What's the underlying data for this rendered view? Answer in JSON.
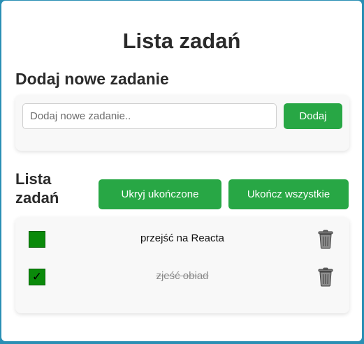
{
  "app": {
    "title": "Lista zadań"
  },
  "add_section": {
    "heading": "Dodaj nowe zadanie",
    "input_placeholder": "Dodaj nowe zadanie..",
    "input_value": "",
    "add_button": "Dodaj"
  },
  "list_section": {
    "heading": "Lista zadań",
    "hide_completed_button": "Ukryj ukończone",
    "complete_all_button": "Ukończ wszystkie",
    "items": [
      {
        "text": "przejść na Reacta",
        "completed": false,
        "check_mark": ""
      },
      {
        "text": "zjeść obiad",
        "completed": true,
        "check_mark": "✓"
      }
    ]
  },
  "colors": {
    "background": "#2a8fb4",
    "button": "#28a745",
    "checkbox": "#0a8a0a",
    "card": "#f8f8f8"
  },
  "icons": {
    "delete": "trash-icon",
    "check": "checkmark-icon"
  }
}
